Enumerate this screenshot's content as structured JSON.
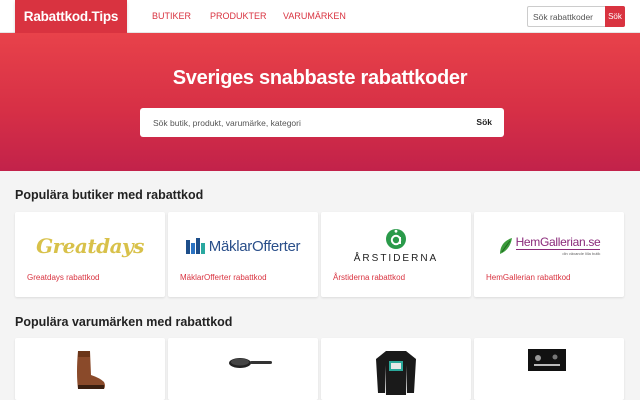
{
  "nav": {
    "logo": "Rabattkod.Tips",
    "links": [
      "BUTIKER",
      "PRODUKTER",
      "VARUMÄRKEN"
    ],
    "search_placeholder": "Sök rabattkoder",
    "search_button": "Sök"
  },
  "hero": {
    "title": "Sveriges snabbaste rabattkoder",
    "search_placeholder": "Sök butik, produkt, varumärke, kategori",
    "search_button": "Sök"
  },
  "stores_section": {
    "title": "Populära butiker med rabattkod",
    "stores": [
      {
        "logo_text": "Greatdays",
        "link": "Greatdays rabattkod"
      },
      {
        "logo_text": "MäklarOfferter",
        "link": "MäklarOfferter rabattkod"
      },
      {
        "logo_text": "ÅRSTIDERNA",
        "link": "Årstiderna rabattkod"
      },
      {
        "logo_text": "HemGallerian.se",
        "logo_subtext": "din växande lilla butik",
        "link": "HemGallerian rabattkod"
      }
    ]
  },
  "brands_section": {
    "title": "Populära varumärken med rabattkod",
    "brands": [
      {
        "icon": "boot-icon"
      },
      {
        "icon": "frying-pan-icon"
      },
      {
        "icon": "sweater-icon"
      },
      {
        "icon": "brand-image-icon"
      }
    ]
  },
  "colors": {
    "brand": "#d93340",
    "greatdays_gold": "#d8c14a",
    "arstiderna_green": "#2a9a4a"
  }
}
